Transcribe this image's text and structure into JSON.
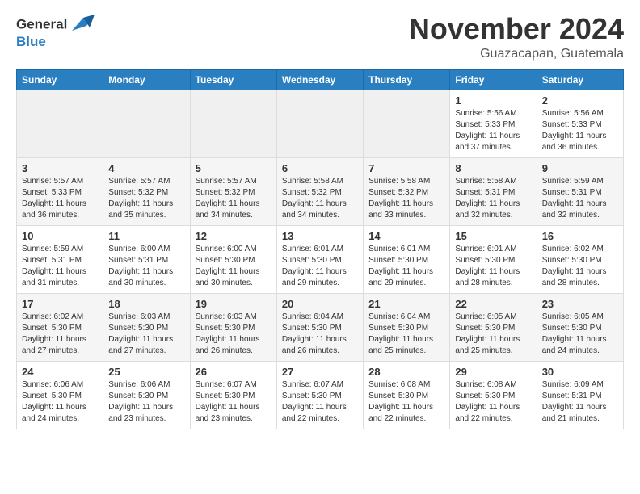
{
  "header": {
    "logo_line1": "General",
    "logo_line2": "Blue",
    "title": "November 2024",
    "subtitle": "Guazacapan, Guatemala"
  },
  "columns": [
    "Sunday",
    "Monday",
    "Tuesday",
    "Wednesday",
    "Thursday",
    "Friday",
    "Saturday"
  ],
  "weeks": [
    [
      {
        "day": "",
        "info": ""
      },
      {
        "day": "",
        "info": ""
      },
      {
        "day": "",
        "info": ""
      },
      {
        "day": "",
        "info": ""
      },
      {
        "day": "",
        "info": ""
      },
      {
        "day": "1",
        "info": "Sunrise: 5:56 AM\nSunset: 5:33 PM\nDaylight: 11 hours\nand 37 minutes."
      },
      {
        "day": "2",
        "info": "Sunrise: 5:56 AM\nSunset: 5:33 PM\nDaylight: 11 hours\nand 36 minutes."
      }
    ],
    [
      {
        "day": "3",
        "info": "Sunrise: 5:57 AM\nSunset: 5:33 PM\nDaylight: 11 hours\nand 36 minutes."
      },
      {
        "day": "4",
        "info": "Sunrise: 5:57 AM\nSunset: 5:32 PM\nDaylight: 11 hours\nand 35 minutes."
      },
      {
        "day": "5",
        "info": "Sunrise: 5:57 AM\nSunset: 5:32 PM\nDaylight: 11 hours\nand 34 minutes."
      },
      {
        "day": "6",
        "info": "Sunrise: 5:58 AM\nSunset: 5:32 PM\nDaylight: 11 hours\nand 34 minutes."
      },
      {
        "day": "7",
        "info": "Sunrise: 5:58 AM\nSunset: 5:32 PM\nDaylight: 11 hours\nand 33 minutes."
      },
      {
        "day": "8",
        "info": "Sunrise: 5:58 AM\nSunset: 5:31 PM\nDaylight: 11 hours\nand 32 minutes."
      },
      {
        "day": "9",
        "info": "Sunrise: 5:59 AM\nSunset: 5:31 PM\nDaylight: 11 hours\nand 32 minutes."
      }
    ],
    [
      {
        "day": "10",
        "info": "Sunrise: 5:59 AM\nSunset: 5:31 PM\nDaylight: 11 hours\nand 31 minutes."
      },
      {
        "day": "11",
        "info": "Sunrise: 6:00 AM\nSunset: 5:31 PM\nDaylight: 11 hours\nand 30 minutes."
      },
      {
        "day": "12",
        "info": "Sunrise: 6:00 AM\nSunset: 5:30 PM\nDaylight: 11 hours\nand 30 minutes."
      },
      {
        "day": "13",
        "info": "Sunrise: 6:01 AM\nSunset: 5:30 PM\nDaylight: 11 hours\nand 29 minutes."
      },
      {
        "day": "14",
        "info": "Sunrise: 6:01 AM\nSunset: 5:30 PM\nDaylight: 11 hours\nand 29 minutes."
      },
      {
        "day": "15",
        "info": "Sunrise: 6:01 AM\nSunset: 5:30 PM\nDaylight: 11 hours\nand 28 minutes."
      },
      {
        "day": "16",
        "info": "Sunrise: 6:02 AM\nSunset: 5:30 PM\nDaylight: 11 hours\nand 28 minutes."
      }
    ],
    [
      {
        "day": "17",
        "info": "Sunrise: 6:02 AM\nSunset: 5:30 PM\nDaylight: 11 hours\nand 27 minutes."
      },
      {
        "day": "18",
        "info": "Sunrise: 6:03 AM\nSunset: 5:30 PM\nDaylight: 11 hours\nand 27 minutes."
      },
      {
        "day": "19",
        "info": "Sunrise: 6:03 AM\nSunset: 5:30 PM\nDaylight: 11 hours\nand 26 minutes."
      },
      {
        "day": "20",
        "info": "Sunrise: 6:04 AM\nSunset: 5:30 PM\nDaylight: 11 hours\nand 26 minutes."
      },
      {
        "day": "21",
        "info": "Sunrise: 6:04 AM\nSunset: 5:30 PM\nDaylight: 11 hours\nand 25 minutes."
      },
      {
        "day": "22",
        "info": "Sunrise: 6:05 AM\nSunset: 5:30 PM\nDaylight: 11 hours\nand 25 minutes."
      },
      {
        "day": "23",
        "info": "Sunrise: 6:05 AM\nSunset: 5:30 PM\nDaylight: 11 hours\nand 24 minutes."
      }
    ],
    [
      {
        "day": "24",
        "info": "Sunrise: 6:06 AM\nSunset: 5:30 PM\nDaylight: 11 hours\nand 24 minutes."
      },
      {
        "day": "25",
        "info": "Sunrise: 6:06 AM\nSunset: 5:30 PM\nDaylight: 11 hours\nand 23 minutes."
      },
      {
        "day": "26",
        "info": "Sunrise: 6:07 AM\nSunset: 5:30 PM\nDaylight: 11 hours\nand 23 minutes."
      },
      {
        "day": "27",
        "info": "Sunrise: 6:07 AM\nSunset: 5:30 PM\nDaylight: 11 hours\nand 22 minutes."
      },
      {
        "day": "28",
        "info": "Sunrise: 6:08 AM\nSunset: 5:30 PM\nDaylight: 11 hours\nand 22 minutes."
      },
      {
        "day": "29",
        "info": "Sunrise: 6:08 AM\nSunset: 5:30 PM\nDaylight: 11 hours\nand 22 minutes."
      },
      {
        "day": "30",
        "info": "Sunrise: 6:09 AM\nSunset: 5:31 PM\nDaylight: 11 hours\nand 21 minutes."
      }
    ]
  ]
}
